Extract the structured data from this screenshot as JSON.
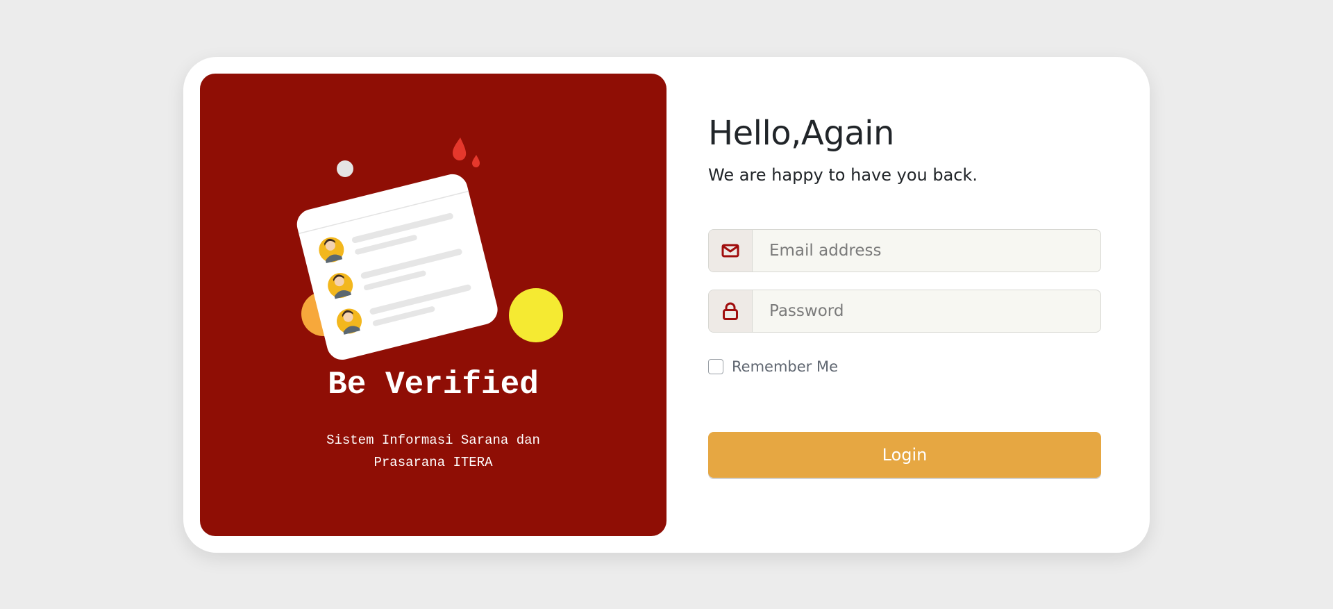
{
  "brand": {
    "title": "Be Verified",
    "subtitle": "Sistem Informasi Sarana dan Prasarana ITERA"
  },
  "login": {
    "heading": "Hello,Again",
    "subheading": "We are happy to have you back.",
    "email": {
      "placeholder": "Email address",
      "value": "",
      "icon": "envelope-icon"
    },
    "password": {
      "placeholder": "Password",
      "value": "",
      "icon": "lock-icon"
    },
    "remember_label": "Remember Me",
    "remember_checked": false,
    "button_label": "Login"
  },
  "colors": {
    "panel": "#8f0e05",
    "accent": "#e6a742",
    "background": "#ececec",
    "icon": "#a00d0d"
  }
}
